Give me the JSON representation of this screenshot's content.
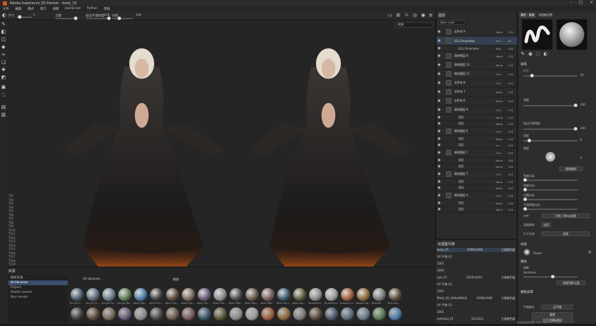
{
  "window": {
    "title": "Adobe Substance 3D Painter - body_02"
  },
  "menu": [
    "文件",
    "编辑",
    "模式",
    "窗口",
    "视图",
    "JavaScript",
    "Python",
    "帮助"
  ],
  "toolbar": {
    "size_label": "尺寸",
    "flow_label": "流量",
    "stroke_opacity_label": "描边不透明度",
    "spacing_label": "间距",
    "v1": "1",
    "v2": "100",
    "v3": "100"
  },
  "viewport": {
    "mode": "材质",
    "overlay_lines": [
      "TX1",
      "TX2",
      "TX3",
      "TX4",
      "TX5",
      "TX6",
      "TX7",
      "TX8",
      "TX9",
      "TX10",
      "TX11",
      "TX12",
      "TX13",
      "TX14",
      "TX15",
      "TX16",
      "TX17",
      "TX18",
      "TX19",
      "TX20",
      "TX21",
      "TX22",
      "TX23"
    ]
  },
  "shelf": {
    "title": "资源",
    "search_left": "搜索资源...",
    "filter_label": "All libraries",
    "search_right": "搜索",
    "tree": [
      "All libraries",
      "Project",
      "Starter assets",
      "Your assets"
    ],
    "materials": [
      "Acrylic C...",
      "Acrylic Gl...",
      "Acrylic Fa...",
      "Acrylic Re...",
      "Alien Gro...",
      "Alien Env...",
      "Alien Gro...",
      "Alien Gro...",
      "Alien Fle...",
      "Alien Gro...",
      "Alien Skin",
      "Alien Sen...",
      "Alien Skin",
      "Alien Surf...",
      "alien wal...",
      "Aluminium",
      "Aluminium",
      "Autumn Li...",
      "Baked Lig...",
      "Bracket",
      "Bull Leg..."
    ]
  },
  "layers": {
    "title": "图层",
    "blend_mode": "Base color",
    "rows": [
      {
        "name": "文件夹 9",
        "blend": "Norm",
        "opacity": "100",
        "type": "layer"
      },
      {
        "name": "SGL Parameter",
        "blend": "Pthr",
        "opacity": "80",
        "type": "sel"
      },
      {
        "name": "SGL Parameter",
        "blend": "Repl",
        "opacity": "100",
        "type": "sub"
      },
      {
        "name": "填充图层 8",
        "blend": "Norm",
        "opacity": "100",
        "type": "layer"
      },
      {
        "name": "填充图层 13",
        "blend": "Norm",
        "opacity": "100",
        "type": "layer"
      },
      {
        "name": "填充图层 11",
        "blend": "Ovrl",
        "opacity": "100",
        "type": "layer"
      },
      {
        "name": "文件夹 8",
        "blend": "Ovrl",
        "opacity": "100",
        "type": "layer"
      },
      {
        "name": "文件夹 7",
        "blend": "Norm",
        "opacity": "100",
        "type": "layer"
      },
      {
        "name": "文件夹 6",
        "blend": "Norm",
        "opacity": "100",
        "type": "layer"
      },
      {
        "name": "填充图层 9",
        "blend": "Ovrl",
        "opacity": "100",
        "type": "layer"
      },
      {
        "name": "锚定",
        "blend": "Norm",
        "opacity": "100",
        "type": "sub"
      },
      {
        "name": "锚定",
        "blend": "Norm",
        "opacity": "100",
        "type": "sub"
      },
      {
        "name": "填充图层 6",
        "blend": "Ovrl",
        "opacity": "100",
        "type": "layer"
      },
      {
        "name": "锚定",
        "blend": "Norm",
        "opacity": "100",
        "type": "sub"
      },
      {
        "name": "锚定",
        "blend": "Lin",
        "opacity": "100",
        "type": "sub"
      },
      {
        "name": "填充图层 7",
        "blend": "Ovrl",
        "opacity": "100",
        "type": "layer"
      },
      {
        "name": "锚定",
        "blend": "Norm",
        "opacity": "100",
        "type": "sub"
      },
      {
        "name": "锚定",
        "blend": "Norm",
        "opacity": "100",
        "type": "sub"
      },
      {
        "name": "填充图层 5",
        "blend": "Ovrl",
        "opacity": "100",
        "type": "layer"
      },
      {
        "name": "锚定",
        "blend": "Norm",
        "opacity": "100",
        "type": "sub"
      },
      {
        "name": "填充",
        "blend": "Norm",
        "opacity": "100",
        "type": "sub"
      },
      {
        "name": "填充图层 4",
        "blend": "Ovrl",
        "opacity": "100",
        "type": "layer"
      },
      {
        "name": "锚定",
        "blend": "Norm",
        "opacity": "100",
        "type": "sub"
      },
      {
        "name": "锚定",
        "blend": "Norm",
        "opacity": "100",
        "type": "sub"
      }
    ]
  },
  "texture_sets": {
    "title": "纹理集列表",
    "rows": [
      {
        "name": "body_01",
        "size": "4096x4096",
        "shader": "主要着色器",
        "sel": true
      },
      {
        "name": "UV 平铺 (2)",
        "size": "",
        "shader": "",
        "sel": false
      },
      {
        "name": "1001",
        "size": "",
        "shader": "",
        "sel": false
      },
      {
        "name": "1002",
        "size": "",
        "shader": "",
        "sel": false
      },
      {
        "name": "eye_01",
        "size": "1024x1024",
        "shader": "主要着色器",
        "sel": false
      },
      {
        "name": "UV 平铺 (2)",
        "size": "",
        "shader": "",
        "sel": false
      },
      {
        "name": "1001",
        "size": "",
        "shader": "",
        "sel": false
      },
      {
        "name": "Mesh_92_defaultMat1",
        "size": "2048x2048",
        "shader": "主要着色器",
        "sel": false
      },
      {
        "name": "UV 平铺 (2)",
        "size": "",
        "shader": "",
        "sel": false
      },
      {
        "name": "1001",
        "size": "",
        "shader": "",
        "sel": false
      },
      {
        "name": "eelmesa_01",
        "size": "512x512",
        "shader": "主要着色器",
        "sel": false
      }
    ]
  },
  "properties": {
    "tabs": [
      "属性 - 画笔",
      "纹理集设置"
    ],
    "section_brush": "画笔",
    "size_label": "尺寸",
    "size_val": "10",
    "flow_label": "流量",
    "flow_val": "100",
    "stroke_label": "描边不透明度",
    "stroke_val": "100",
    "spacing_label": "间距",
    "spacing_val": "8",
    "angle_label": "角度",
    "angle_val": "0",
    "follow_label": "跟随路径",
    "jitter_labels": [
      "角度抖动",
      "角度抖动",
      "位置抖动",
      "不透明度抖动",
      "流量抖动"
    ],
    "alignment_label": "对齐",
    "alignment_val": "切线 | Wrap包裹",
    "backface_label": "背面剔除",
    "backface_val": "启用",
    "size_space_label": "尺寸空间",
    "size_space_val": "纹理",
    "alpha_label": "透明",
    "alpha_val": "Shape",
    "section_attr": "属性",
    "param_label": "参数",
    "hardness_label": "Hardness",
    "reset_btn": "恢复到默认值",
    "section_stencil": "模板遮罩",
    "tiling_label": "平铺模式",
    "tiling_val": "无平铺",
    "stencil_btn": "重置",
    "stencil_btn2": "交互式模板图层",
    "section_material": "材质",
    "footer": "缓存磁盘使用率: 31% | Version: 9.0.1"
  },
  "colors": {
    "accent": "#d95a1e",
    "panel": "#2b2b2b",
    "selection": "#33404f"
  }
}
